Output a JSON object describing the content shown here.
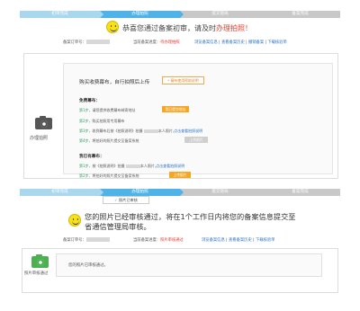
{
  "top": {
    "steps": [
      {
        "label": "初审完成",
        "state": "done"
      },
      {
        "label": "办理拍照",
        "state": "current"
      },
      {
        "label": "提交管局",
        "state": "todo"
      },
      {
        "label": "备案完成",
        "state": "todo"
      }
    ],
    "title_prefix": "恭喜您通过备案初审，请及时",
    "title_highlight": "办理拍照！",
    "order_label": "备案订单号：",
    "status_label": "当前备案进度：",
    "status_value": "待办理拍照",
    "links": [
      "浏览备案信息",
      "查看备案历史",
      "撤销备案",
      "下载核验单"
    ],
    "photo_label": "办理拍照",
    "buy_text": "购买收费幕布，自行拍照后上传",
    "tip_button": "* 幕布使用帮助说明",
    "unpaid": {
      "title": "免费幕布：",
      "steps": [
        {
          "no": "第1步，",
          "text": "请您提供收费幕布邮寄地址",
          "button": "我已提交地址"
        },
        {
          "no": "第2步，",
          "text": "购买拍照用专用幕布"
        },
        {
          "no": "第3步，",
          "text": "收到幕布后按《拍照说明》拍摄",
          "text2": "本人照片,",
          "link": "点击查看拍照说明"
        },
        {
          "no": "第4步，",
          "text": "将拍好的照片提交至备案系统",
          "button": "上传照片"
        }
      ]
    },
    "paid": {
      "title": "我已有幕布：",
      "steps": [
        {
          "no": "第1步，",
          "text": "按《拍照说明》拍摄",
          "text2": "本人照片,",
          "link": "点击查看拍照说明"
        },
        {
          "no": "第2步，",
          "text": "将拍好的照片提交至备案系统",
          "button": "上传照片"
        }
      ]
    }
  },
  "bottom": {
    "steps": [
      {
        "label": "初审完成",
        "state": "done"
      },
      {
        "label": "办理拍照",
        "state": "current"
      },
      {
        "label": "提交管局",
        "state": "todo"
      },
      {
        "label": "备案完成",
        "state": "todo"
      }
    ],
    "tooltip": "照片已审核",
    "title": "您的照片已经审核通过，将在1个工作日内将您的备案信息提交至省通信管理局审核。",
    "order_label": "备案订单号：",
    "status_label": "当前备案进度：",
    "status_value": "照片审核通过",
    "links": [
      "浏览备案信息",
      "查看备案历史",
      "下载核验单"
    ],
    "photo_label": "照片审核通过",
    "approved_text": "您的照片已审核通过。"
  },
  "colors": {
    "current_step": "#4fb3e8",
    "done_step": "#a9d7ee",
    "todo_step": "#c8c8c8",
    "highlight": "#e63b2e",
    "accent_orange": "#f5a623",
    "link": "#2a72c4"
  }
}
